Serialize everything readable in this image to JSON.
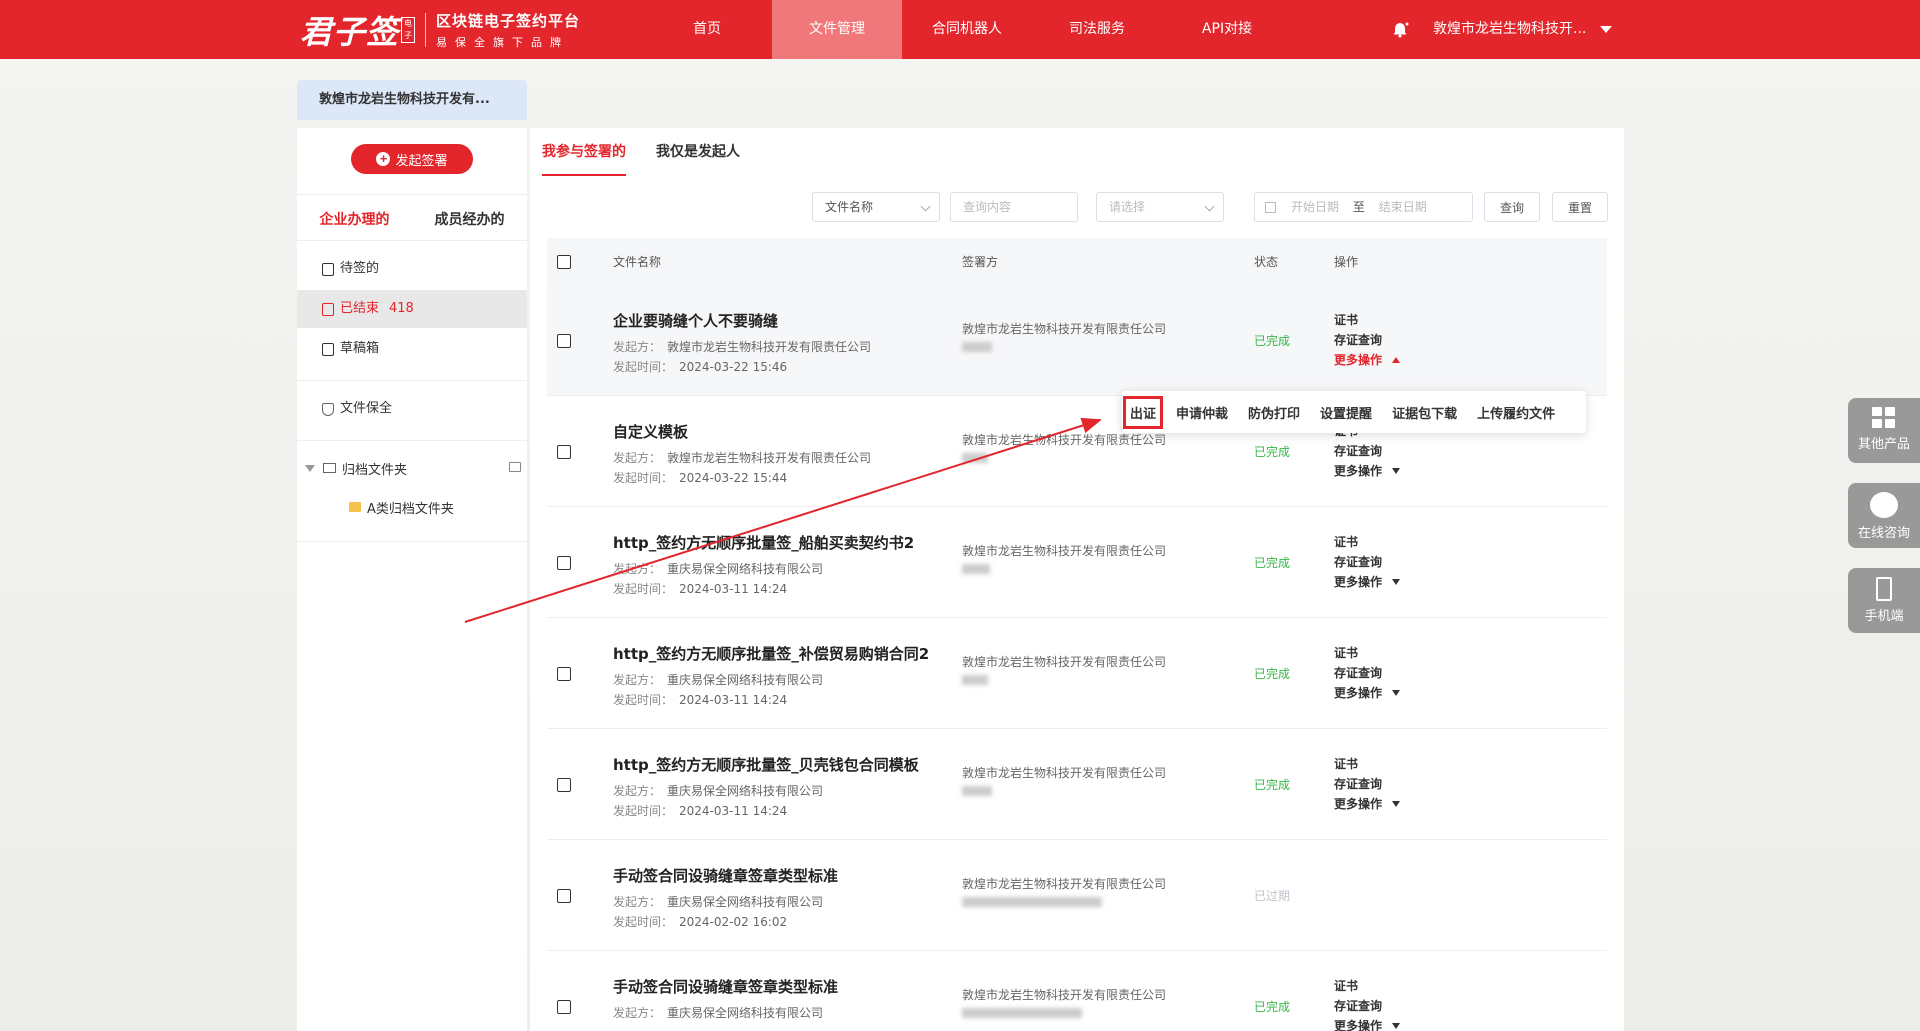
{
  "topbar": {
    "logo_main": "君子签",
    "logo_seal": "电子",
    "logo_title": "区块链电子签约平台",
    "logo_sub": "易保全旗下品牌",
    "nav": [
      "首页",
      "文件管理",
      "合同机器人",
      "司法服务",
      "API对接"
    ],
    "active_nav": "文件管理",
    "company": "敦煌市龙岩生物科技开..."
  },
  "company_tab": "敦煌市龙岩生物科技开发有...",
  "sidebar": {
    "launch_button": "发起签署",
    "tabs": [
      "企业办理的",
      "成员经办的"
    ],
    "items": [
      {
        "label": "待签的"
      },
      {
        "label": "已结束",
        "count": "418"
      },
      {
        "label": "草稿箱"
      }
    ],
    "preserve": "文件保全",
    "archive": "归档文件夹",
    "subfolder": "A类归档文件夹"
  },
  "main": {
    "tabs": [
      "我参与签署的",
      "我仅是发起人"
    ],
    "filters": {
      "field_select": "文件名称",
      "query_placeholder": "查询内容",
      "status_placeholder": "请选择",
      "start_date": "开始日期",
      "date_sep": "至",
      "end_date": "结束日期",
      "search_button": "查询",
      "reset_button": "重置"
    },
    "columns": [
      "文件名称",
      "签署方",
      "状态",
      "操作"
    ],
    "initiator_label": "发起方：",
    "time_label": "发起时间：",
    "rows": [
      {
        "title": "企业要骑缝个人不要骑缝",
        "initiator": "敦煌市龙岩生物科技开发有限责任公司",
        "time": "2024-03-22 15:46",
        "signer": "敦煌市龙岩生物科技开发有限责任公司",
        "status": "已完成",
        "ops": [
          "证书",
          "存证查询",
          "更多操作"
        ]
      },
      {
        "title": "自定义模板",
        "initiator": "敦煌市龙岩生物科技开发有限责任公司",
        "time": "2024-03-22 15:44",
        "signer": "敦煌市龙岩生物科技开发有限责任公司",
        "status": "已完成",
        "ops": [
          "证书",
          "存证查询",
          "更多操作"
        ]
      },
      {
        "title": "http_签约方无顺序批量签_船舶买卖契约书2",
        "initiator": "重庆易保全网络科技有限公司",
        "time": "2024-03-11 14:24",
        "signer": "敦煌市龙岩生物科技开发有限责任公司",
        "status": "已完成",
        "ops": [
          "证书",
          "存证查询",
          "更多操作"
        ]
      },
      {
        "title": "http_签约方无顺序批量签_补偿贸易购销合同2",
        "initiator": "重庆易保全网络科技有限公司",
        "time": "2024-03-11 14:24",
        "signer": "敦煌市龙岩生物科技开发有限责任公司",
        "status": "已完成",
        "ops": [
          "证书",
          "存证查询",
          "更多操作"
        ]
      },
      {
        "title": "http_签约方无顺序批量签_贝壳钱包合同模板",
        "initiator": "重庆易保全网络科技有限公司",
        "time": "2024-03-11 14:24",
        "signer": "敦煌市龙岩生物科技开发有限责任公司",
        "status": "已完成",
        "ops": [
          "证书",
          "存证查询",
          "更多操作"
        ]
      },
      {
        "title": "手动签合同设骑缝章签章类型标准",
        "initiator": "重庆易保全网络科技有限公司",
        "time": "2024-02-02 16:02",
        "signer": "敦煌市龙岩生物科技开发有限责任公司",
        "status": "已过期",
        "ops": []
      },
      {
        "title": "手动签合同设骑缝章签章类型标准",
        "initiator": "重庆易保全网络科技有限公司",
        "time": "",
        "signer": "敦煌市龙岩生物科技开发有限责任公司",
        "status": "已完成",
        "ops": [
          "证书",
          "存证查询",
          "更多操作"
        ]
      }
    ],
    "popover": [
      "出证",
      "申请仲裁",
      "防伪打印",
      "设置提醒",
      "证据包下载",
      "上传履约文件"
    ]
  },
  "float": [
    "其他产品",
    "在线咨询",
    "手机端"
  ],
  "colors": {
    "brand": "#e3262c",
    "done": "#3ab54a",
    "expired": "#c0c4cc"
  }
}
